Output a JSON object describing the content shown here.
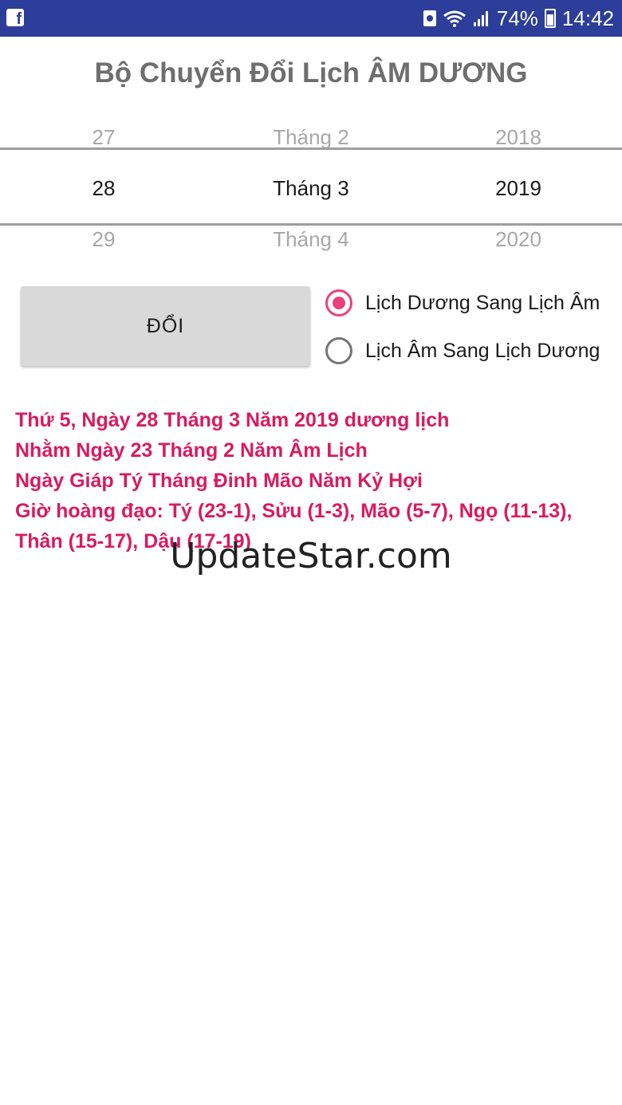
{
  "status_bar": {
    "battery": "74%",
    "time": "14:42",
    "icons": [
      "facebook-icon",
      "recycle-icon",
      "wifi-icon",
      "signal-icon",
      "battery-icon"
    ]
  },
  "title": "Bộ Chuyển Đổi Lịch ÂM DƯƠNG",
  "picker": {
    "prev": {
      "day": "27",
      "month": "Tháng 2",
      "year": "2018"
    },
    "current": {
      "day": "28",
      "month": "Tháng 3",
      "year": "2019"
    },
    "next": {
      "day": "29",
      "month": "Tháng 4",
      "year": "2020"
    }
  },
  "convert_button": "ĐỔI",
  "options": [
    {
      "label": "Lịch Dương Sang Lịch Âm",
      "selected": true
    },
    {
      "label": "Lịch Âm Sang Lịch Dương",
      "selected": false
    }
  ],
  "result": {
    "line1": "Thứ 5, Ngày 28 Tháng 3 Năm 2019 dương lịch",
    "line2": "Nhằm Ngày 23 Tháng 2 Năm Âm Lịch",
    "line3": "Ngày Giáp Tý Tháng Đinh Mão Năm Kỷ Hợi",
    "line4": "Giờ hoàng đạo: Tý (23-1), Sửu (1-3), Mão (5-7), Ngọ (11-13),",
    "line5": "Thân (15-17), Dậu (17-19)"
  },
  "watermark": "UpdateStar.com",
  "colors": {
    "status_bar": "#2c3e99",
    "accent": "#ec407a",
    "result_text": "#d81b60"
  }
}
